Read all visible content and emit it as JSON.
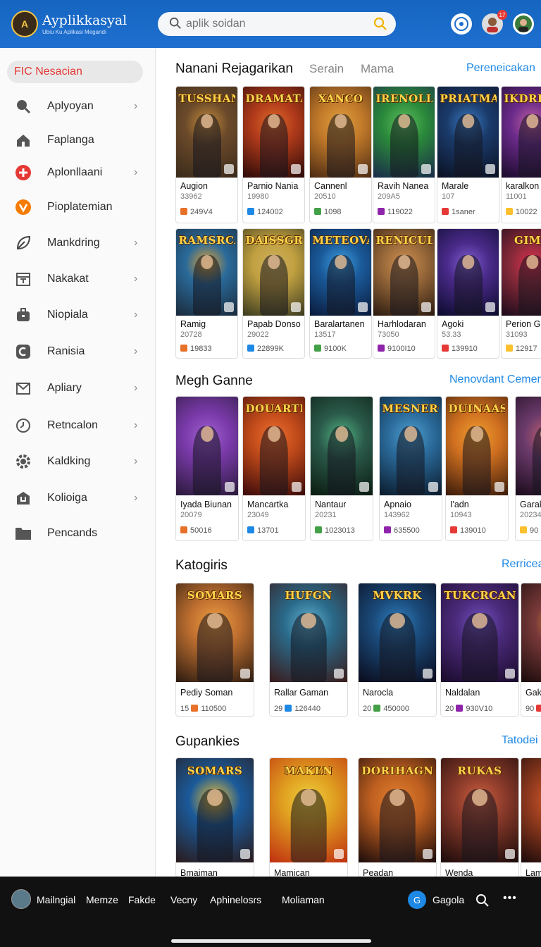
{
  "header": {
    "logo_text": "A",
    "brand": "Ayplikkasyal",
    "brand_sub": "Ubiu Ku Aplikasi Megandi",
    "search_placeholder": "aplik soidan",
    "notif_badge": "17"
  },
  "sidebar": {
    "active": "FIC Nesacian",
    "items": [
      {
        "label": "Aplyoyan",
        "icon": "search-icon",
        "chevron": true
      },
      {
        "label": "Faplanga",
        "icon": "home-icon",
        "chevron": false
      },
      {
        "label": "Aplonllaani",
        "icon": "plus-circle-icon",
        "chevron": true,
        "color": "#e53935"
      },
      {
        "label": "Pioplatemian",
        "icon": "v-badge-icon",
        "chevron": false,
        "color": "#f57c00"
      },
      {
        "label": "Mankdring",
        "icon": "leaf-icon",
        "chevron": true
      },
      {
        "label": "Nakakat",
        "icon": "calendar-icon",
        "chevron": true
      },
      {
        "label": "Niopiala",
        "icon": "briefcase-icon",
        "chevron": true
      },
      {
        "label": "Ranisia",
        "icon": "c-badge-icon",
        "chevron": true
      },
      {
        "label": "Apliary",
        "icon": "mail-icon",
        "chevron": true
      },
      {
        "label": "Retncalon",
        "icon": "clock-icon",
        "chevron": true
      },
      {
        "label": "Kaldking",
        "icon": "gear-icon",
        "chevron": true
      },
      {
        "label": "Kolioiga",
        "icon": "u-box-icon",
        "chevron": true
      },
      {
        "label": "Pencands",
        "icon": "folder-icon",
        "chevron": false
      }
    ]
  },
  "sections": {
    "s1": {
      "title": "Nanani Rejagarikan",
      "tabs": [
        "Serain",
        "Mama"
      ],
      "link": "Pereneicakan"
    },
    "s2": {
      "title": "Megh Ganne",
      "link": "Nenovdant Cemer"
    },
    "s3": {
      "title": "Katogiris",
      "link": "Rerricea"
    },
    "s4": {
      "title": "Gupankies",
      "link": "Tatodei"
    }
  },
  "row1": [
    {
      "name": "Augion",
      "year": "33962",
      "stat": "249V4",
      "art": "TUSSHANT",
      "c1": "#6b4a2a",
      "c2": "#3a2a1a",
      "tint": "#c48a3a"
    },
    {
      "name": "Parnio Nania",
      "year": "19980",
      "stat": "124002",
      "art": "DRAMATAS",
      "c1": "#b03a1a",
      "c2": "#2a0a08",
      "tint": "#e06a2a"
    },
    {
      "name": "Cannenl",
      "year": "20510",
      "stat": "1098",
      "art": "XANCO",
      "c1": "#c27a2a",
      "c2": "#4a2a12",
      "tint": "#e0a040"
    },
    {
      "name": "Ravih Nanea",
      "year": "209A5",
      "stat": "119022",
      "art": "IRENOLIANE",
      "c1": "#2a8a3a",
      "c2": "#1a2a4a",
      "tint": "#60c060"
    },
    {
      "name": "Marale",
      "year": "107",
      "stat": "1saner",
      "art": "PRIATMAN",
      "c1": "#1a3a6a",
      "c2": "#0a1020",
      "tint": "#3a7ac0"
    },
    {
      "name": "karalkon",
      "year": "11001",
      "stat": "10022",
      "art": "IKDREKA",
      "c1": "#6a2a8a",
      "c2": "#1a0a2a",
      "tint": "#c060a0"
    }
  ],
  "row2": [
    {
      "name": "Ramig",
      "year": "20728",
      "stat": "19833",
      "art": "RAMSRCAS",
      "c1": "#2a6a9a",
      "c2": "#1a2a3a",
      "tint": "#e0a030"
    },
    {
      "name": "Papab Donso",
      "year": "29022",
      "stat": "22899K",
      "art": "DAISSGRU",
      "c1": "#c0a040",
      "c2": "#3a3a20",
      "tint": "#d0b060"
    },
    {
      "name": "Baralartanen",
      "year": "13517",
      "stat": "9100K",
      "art": "METEOVANI",
      "c1": "#1a5a9a",
      "c2": "#0a1a3a",
      "tint": "#40a0e0"
    },
    {
      "name": "Harhlodaran",
      "year": "73050",
      "stat": "9100I10",
      "art": "RENICULS",
      "c1": "#9a6a3a",
      "c2": "#2a1a10",
      "tint": "#d09050"
    },
    {
      "name": "Agoki",
      "year": "53.33",
      "stat": "139910",
      "art": "",
      "c1": "#4a2a8a",
      "c2": "#0a0a2a",
      "tint": "#8060d0"
    },
    {
      "name": "Perion Ga",
      "year": "31093",
      "stat": "12917",
      "art": "GIMR",
      "c1": "#8a2a3a",
      "c2": "#1a0a1a",
      "tint": "#e03050"
    }
  ],
  "row3": [
    {
      "name": "Iyada Biunan",
      "year": "20079",
      "stat": "50016",
      "art": "",
      "c1": "#7a3aaa",
      "c2": "#2a1a3a",
      "tint": "#a060d0"
    },
    {
      "name": "Mancartka",
      "year": "23049",
      "stat": "13701",
      "art": "DOUARTRS",
      "c1": "#c04a1a",
      "c2": "#3a0a0a",
      "tint": "#f07030"
    },
    {
      "name": "Nantaur",
      "year": "20231",
      "stat": "1023013",
      "art": "",
      "c1": "#2a5a4a",
      "c2": "#0a1a10",
      "tint": "#50b080"
    },
    {
      "name": "Apnaio",
      "year": "143962",
      "stat": "635500",
      "art": "MESNERGS",
      "c1": "#2a6a9a",
      "c2": "#0a1a2a",
      "tint": "#50a0d0"
    },
    {
      "name": "I'adn",
      "year": "10943",
      "stat": "139010",
      "art": "DUINAAS",
      "c1": "#d07020",
      "c2": "#3a1a0a",
      "tint": "#f0a030"
    },
    {
      "name": "Garak",
      "year": "20234",
      "stat": "90",
      "art": "",
      "c1": "#6a3a6a",
      "c2": "#1a0a1a",
      "tint": "#c06070"
    }
  ],
  "row4": [
    {
      "name": "Pediy Soman",
      "year": "15",
      "stat": "110500",
      "art": "SOMARS",
      "c1": "#c07030",
      "c2": "#2a1a10",
      "tint": "#f0a040"
    },
    {
      "name": "Rallar Gaman",
      "year": "29",
      "stat": "126440",
      "art": "HUFGN",
      "c1": "#2a6a8a",
      "c2": "#3a1a1a",
      "tint": "#60b0d0"
    },
    {
      "name": "Narocla",
      "year": "20",
      "stat": "450000",
      "art": "MVKRK",
      "c1": "#1a4a7a",
      "c2": "#0a0a1a",
      "tint": "#3080c0"
    },
    {
      "name": "Naldalan",
      "year": "20",
      "stat": "930V10",
      "art": "TUKCRCANI",
      "c1": "#4a2a7a",
      "c2": "#1a0a2a",
      "tint": "#7050c0"
    },
    {
      "name": "Gak",
      "year": "90",
      "stat": "",
      "art": "S",
      "c1": "#7a3a3a",
      "c2": "#1a0a0a",
      "tint": "#e0a030"
    }
  ],
  "row5": [
    {
      "name": "Bmaiman",
      "art": "SOMARS",
      "c1": "#1a5a9a",
      "c2": "#2a1a1a",
      "tint": "#f0c030"
    },
    {
      "name": "Mamican",
      "art": "MAKEN",
      "c1": "#e0a020",
      "c2": "#c03010",
      "tint": "#f0d040"
    },
    {
      "name": "Peadan",
      "art": "DORIHAGN",
      "c1": "#c06020",
      "c2": "#1a0a0a",
      "tint": "#e08030"
    },
    {
      "name": "Wenda",
      "art": "RUKAS",
      "c1": "#8a3a2a",
      "c2": "#1a0a0a",
      "tint": "#d06040"
    },
    {
      "name": "Lam",
      "art": "",
      "c1": "#a04020",
      "c2": "#1a0a0a",
      "tint": "#e07030"
    }
  ],
  "bottombar": {
    "items": [
      "Mailngial",
      "Memze",
      "Fakde",
      "Vecny",
      "Aphinelosrs",
      "Moliaman"
    ],
    "right_label": "Gagola",
    "round_letter": "G",
    "more": "•••"
  }
}
